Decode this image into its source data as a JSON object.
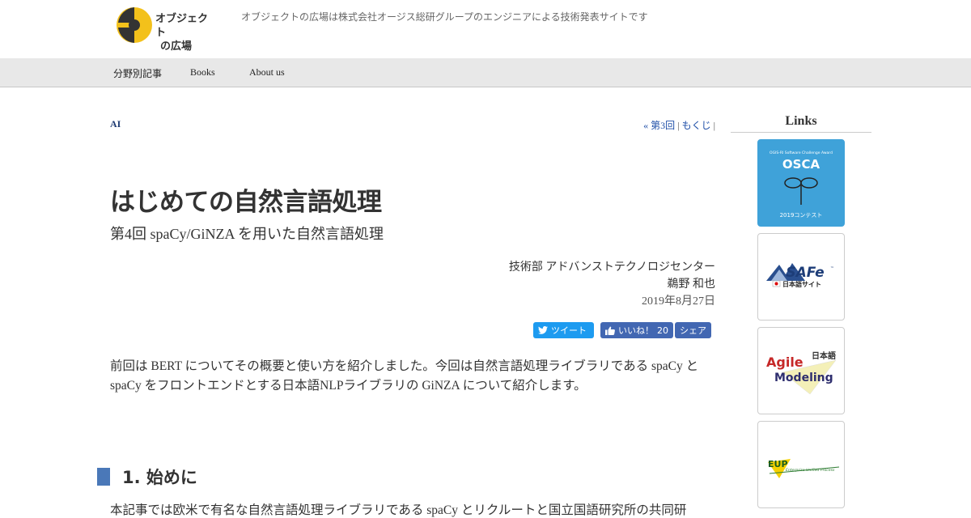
{
  "header": {
    "logo_text_line1": "オブジェクト",
    "logo_text_line2": "の広場",
    "tagline": "オブジェクトの広場は株式会社オージス総研グループのエンジニアによる技術発表サイトです"
  },
  "nav": {
    "items": [
      {
        "label": "分野別記事"
      },
      {
        "label": "Books"
      },
      {
        "label": "About us"
      }
    ]
  },
  "article": {
    "category": "AI",
    "pager": {
      "prev": "« 第3回",
      "sep1": " | ",
      "toc": "もくじ",
      "sep2": " |"
    },
    "title": "はじめての自然言語処理",
    "subtitle": "第4回 spaCy/GiNZA を用いた自然言語処理",
    "author": {
      "department": "技術部 アドバンストテクノロジセンター",
      "name": "鵜野 和也",
      "date": "2019年8月27日"
    },
    "share": {
      "tweet": "ツイート",
      "like": "いいね！",
      "like_count": "20",
      "share": "シェア"
    },
    "intro": "前回は BERT についてその概要と使い方を紹介しました。今回は自然言語処理ライブラリである spaCy と spaCy をフロントエンドとする日本語NLPライブラリの GiNZA について紹介します。",
    "section1_title": "1. 始めに",
    "section1_text": "本記事では欧米で有名な自然言語処理ライブラリである spaCy とリクルートと国立国語研究所の共同研"
  },
  "sidebar": {
    "title": "Links",
    "banners": [
      {
        "caption_top": "OGIS-RI Software Challenge Award",
        "name": "OSCA",
        "caption_bottom": "2019コンテスト",
        "color": "#3fa2d9"
      },
      {
        "name": "SAFe",
        "tm": "™",
        "caption": "日本語サイト"
      },
      {
        "line1": "Agile",
        "line2": "Modeling",
        "jp": "日本語"
      },
      {
        "name": "EUP",
        "caption": "Enterprise Unified Process"
      }
    ]
  }
}
